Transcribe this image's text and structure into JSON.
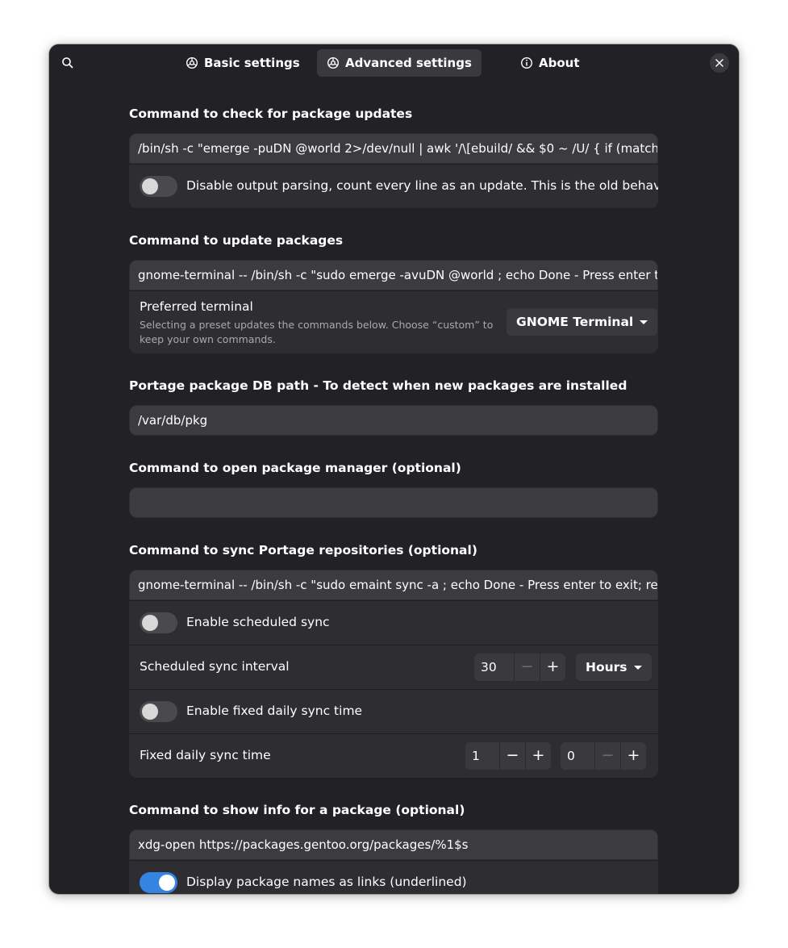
{
  "header": {
    "tabs": [
      {
        "label": "Basic settings",
        "icon": "gear-icon",
        "active": false
      },
      {
        "label": "Advanced settings",
        "icon": "gear-icon",
        "active": true
      },
      {
        "label": "About",
        "icon": "info-icon",
        "active": false
      }
    ]
  },
  "check_updates": {
    "title": "Command to check for package updates",
    "command": "/bin/sh -c \"emerge -puDN @world 2>/dev/null | awk '/\\[ebuild/ && $0 ~ /U/ { if (match($",
    "disable_parsing_label": "Disable output parsing, count every line as an update. This is the old behavior.",
    "disable_parsing_on": false
  },
  "update_packages": {
    "title": "Command to update packages",
    "command": "gnome-terminal -- /bin/sh -c \"sudo emerge -avuDN @world ; echo Done - Press enter to",
    "terminal_label": "Preferred terminal",
    "terminal_desc": "Selecting a preset updates the commands below. Choose “custom” to keep your own commands.",
    "terminal_value": "GNOME Terminal"
  },
  "db_path": {
    "title": "Portage package DB path - To detect when new packages are installed",
    "value": "/var/db/pkg"
  },
  "package_manager": {
    "title": "Command to open package manager (optional)",
    "value": ""
  },
  "sync": {
    "title": "Command to sync Portage repositories (optional)",
    "command": "gnome-terminal -- /bin/sh -c \"sudo emaint sync -a ; echo Done - Press enter to exit; read",
    "scheduled_label": "Enable scheduled sync",
    "scheduled_on": false,
    "interval_label": "Scheduled sync interval",
    "interval_value": "30",
    "interval_unit": "Hours",
    "fixed_label": "Enable fixed daily sync time",
    "fixed_on": false,
    "fixed_time_label": "Fixed daily sync time",
    "fixed_hour": "1",
    "fixed_minute": "0"
  },
  "info": {
    "title": "Command to show info for a package (optional)",
    "command": "xdg-open https://packages.gentoo.org/packages/%1$s",
    "links_label": "Display package names as links (underlined)",
    "links_on": true
  },
  "colors": {
    "window_bg": "#222226",
    "card_bg": "#2e2e32",
    "entry_bg": "#3c3c40",
    "accent": "#3584e4"
  }
}
